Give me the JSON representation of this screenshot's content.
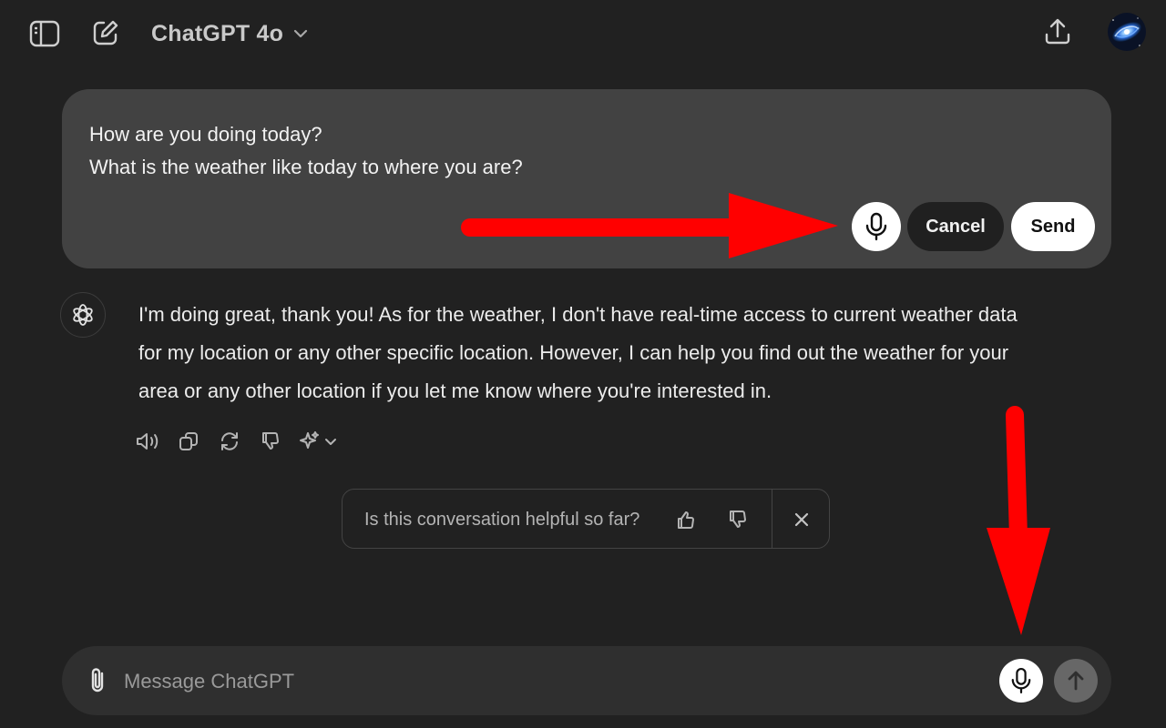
{
  "header": {
    "model_name": "ChatGPT 4o",
    "icons": [
      "sidebar-toggle-icon",
      "new-chat-icon",
      "chevron-down-icon",
      "share-upload-icon"
    ]
  },
  "edit_message": {
    "lines": [
      "How are you doing today?",
      "What is the weather like today to where you are?"
    ],
    "cancel_label": "Cancel",
    "send_label": "Send"
  },
  "assistant": {
    "lines": [
      "I'm doing great, thank you! As for the weather, I don't have real-time access to current weather data",
      "for my location or any other specific location. However, I can help you find out the weather for your",
      "area or any other location if you let me know where you're interested in."
    ],
    "actions": [
      "read-aloud-icon",
      "copy-icon",
      "regenerate-icon",
      "thumbs-down-icon",
      "sparkle-model-icon"
    ]
  },
  "feedback": {
    "question": "Is this conversation helpful so far?"
  },
  "composer": {
    "placeholder": "Message ChatGPT"
  },
  "colors": {
    "background": "#212121",
    "card": "#424242",
    "composer": "#2f2f2f",
    "annotation_arrow": "#ff0000"
  }
}
